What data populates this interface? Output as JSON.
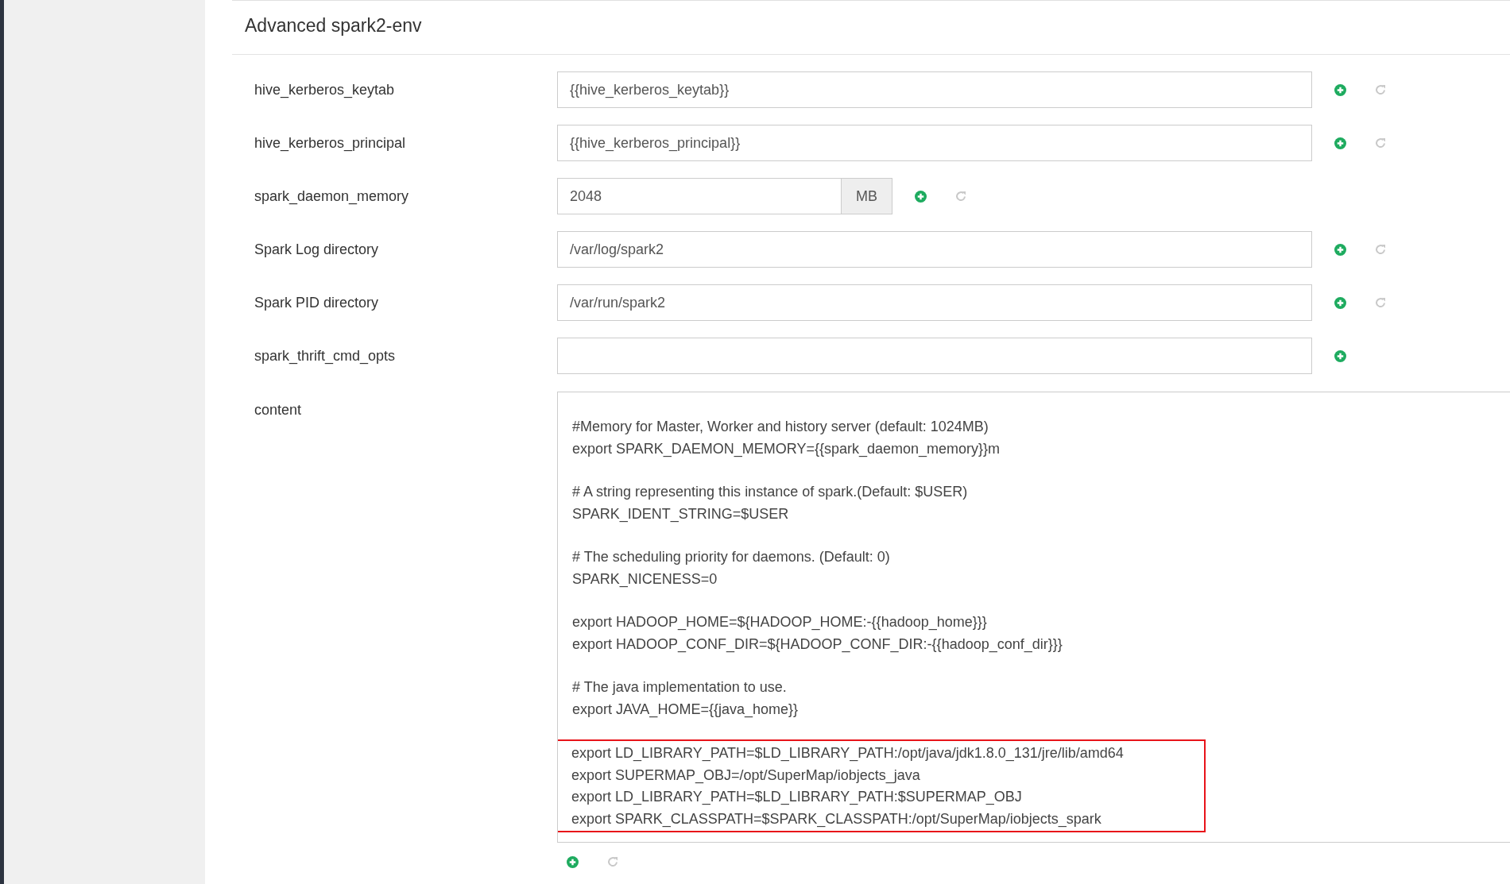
{
  "section": {
    "title": "Advanced spark2-env"
  },
  "fields": [
    {
      "label": "hive_kerberos_keytab",
      "value": "{{hive_kerberos_keytab}}",
      "kind": "text",
      "can_reset": true
    },
    {
      "label": "hive_kerberos_principal",
      "value": "{{hive_kerberos_principal}}",
      "kind": "text",
      "can_reset": true
    },
    {
      "label": "spark_daemon_memory",
      "value": "2048",
      "unit": "MB",
      "kind": "unit",
      "can_reset": true
    },
    {
      "label": "Spark Log directory",
      "value": "/var/log/spark2",
      "kind": "text",
      "can_reset": true
    },
    {
      "label": "Spark PID directory",
      "value": "/var/run/spark2",
      "kind": "text",
      "can_reset": true
    },
    {
      "label": "spark_thrift_cmd_opts",
      "kind": "text",
      "can_reset": false
    }
  ],
  "content": {
    "label": "content",
    "can_reset": true,
    "blocks": [
      {
        "highlighted": false,
        "lines": [
          "#Memory for Master, Worker and history server (default: 1024MB)",
          "export SPARK_DAEMON_MEMORY={{spark_daemon_memory}}m"
        ]
      },
      {
        "highlighted": false,
        "lines": [
          "# A string representing this instance of spark.(Default: $USER)",
          "SPARK_IDENT_STRING=$USER"
        ]
      },
      {
        "highlighted": false,
        "lines": [
          "# The scheduling priority for daemons. (Default: 0)",
          "SPARK_NICENESS=0"
        ]
      },
      {
        "highlighted": false,
        "lines": [
          "export HADOOP_HOME=${HADOOP_HOME:-{{hadoop_home}}}",
          "export HADOOP_CONF_DIR=${HADOOP_CONF_DIR:-{{hadoop_conf_dir}}}"
        ]
      },
      {
        "highlighted": false,
        "lines": [
          "# The java implementation to use.",
          "export JAVA_HOME={{java_home}}"
        ]
      },
      {
        "highlighted": true,
        "lines": [
          "export LD_LIBRARY_PATH=$LD_LIBRARY_PATH:/opt/java/jdk1.8.0_131/jre/lib/amd64",
          "export SUPERMAP_OBJ=/opt/SuperMap/iobjects_java",
          "export LD_LIBRARY_PATH=$LD_LIBRARY_PATH:$SUPERMAP_OBJ",
          "export SPARK_CLASSPATH=$SPARK_CLASSPATH:/opt/SuperMap/iobjects_spark"
        ]
      }
    ]
  }
}
